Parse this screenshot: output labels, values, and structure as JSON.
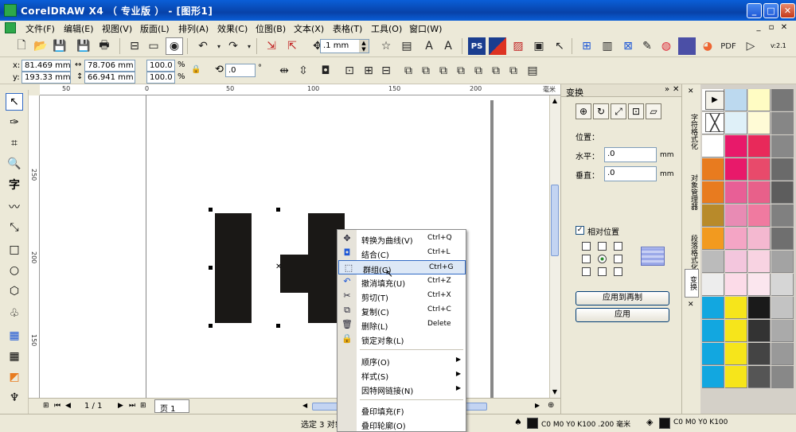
{
  "window": {
    "title": "CorelDRAW X4 （ 专业版 ） - [图形1]",
    "minimize": "_",
    "maximize": "□",
    "close": "✕"
  },
  "menu": [
    "文件(F)",
    "编辑(E)",
    "视图(V)",
    "版面(L)",
    "排列(A)",
    "效果(C)",
    "位图(B)",
    "文本(X)",
    "表格(T)",
    "工具(O)",
    "窗口(W)"
  ],
  "mdi": {
    "min": "_",
    "restore": "▫",
    "close": "✕"
  },
  "toolbar": {
    "nudge_value": ".1 mm",
    "ver_label": "v:2.1"
  },
  "propbar": {
    "x_label": "x:",
    "x_value": "81.469 mm",
    "y_label": "y:",
    "y_value": "193.33 mm",
    "w_value": "78.706 mm",
    "h_value": "66.941 mm",
    "sx_value": "100.0",
    "sy_value": "100.0",
    "pct": "%",
    "rot_value": ".0",
    "deg": "°"
  },
  "rulers": {
    "h_ticks": [
      "50",
      "0",
      "50",
      "100",
      "150",
      "200",
      "毫米"
    ],
    "v_ticks": [
      "250",
      "200",
      "150"
    ]
  },
  "context_menu": {
    "items": [
      {
        "label": "转换为曲线(V)",
        "shortcut": "Ctrl+Q",
        "icon": "convert-curves-icon"
      },
      {
        "label": "结合(C)",
        "shortcut": "Ctrl+L",
        "icon": "combine-icon"
      },
      {
        "label": "群组(G)",
        "shortcut": "Ctrl+G",
        "icon": "group-icon",
        "highlight": true
      },
      {
        "label": "撤消填充(U)",
        "shortcut": "Ctrl+Z",
        "icon": "undo-icon"
      },
      {
        "label": "剪切(T)",
        "shortcut": "Ctrl+X",
        "icon": "cut-icon"
      },
      {
        "label": "复制(C)",
        "shortcut": "Ctrl+C",
        "icon": "copy-icon"
      },
      {
        "label": "删除(L)",
        "shortcut": "Delete",
        "icon": "delete-icon"
      },
      {
        "label": "锁定对象(L)",
        "shortcut": "",
        "icon": "lock-icon"
      }
    ],
    "submenus": [
      {
        "label": "顺序(O)"
      },
      {
        "label": "样式(S)"
      },
      {
        "label": "因特网链接(N)"
      }
    ],
    "bottom": [
      {
        "label": "叠印填充(F)"
      },
      {
        "label": "叠印轮廓(O)"
      }
    ]
  },
  "docker": {
    "title": "变换",
    "position_label": "位置：",
    "horizontal_label": "水平：",
    "horizontal_value": ".0",
    "vertical_label": "垂直：",
    "vertical_value": ".0",
    "unit": "mm",
    "relative_label": "相对位置",
    "relative_checked": true,
    "apply_dup": "应用到再制",
    "apply": "应用"
  },
  "side_tabs": [
    "字符格式化",
    "对象管理器",
    "段落格式化",
    "变换"
  ],
  "status": {
    "page_count": "1 / 1",
    "page_tab": "页 1",
    "selection_text": "选定 3 对象",
    "fill_info": "C0 M0 Y0 K100  .200 毫米",
    "outline_info": "C0 M0 Y0 K100"
  },
  "palette_colors": [
    [
      "#ffffff",
      "#bcd9ef",
      "#fffcc3",
      "#777777"
    ],
    [
      "#ffffff",
      "#dff0f8",
      "#fffbd6",
      "#868686"
    ],
    [
      "#ffffff",
      "#e8196a",
      "#e8295a",
      "#888888"
    ],
    [
      "#e87b1f",
      "#e8196a",
      "#e84a6b",
      "#6a6a6a"
    ],
    [
      "#e87b1f",
      "#e85f96",
      "#e8608a",
      "#5d5d5d"
    ],
    [
      "#b88a2a",
      "#e88bb4",
      "#f07aa0",
      "#808080"
    ],
    [
      "#f29a1f",
      "#f4a5c5",
      "#f4b8d0",
      "#6f6f6f"
    ],
    [
      "#bbbbbb",
      "#f3c6dd",
      "#f8d3e2",
      "#a3a3a3"
    ],
    [
      "#ededed",
      "#fcdbe8",
      "#fbe6ee",
      "#d6d6d6"
    ],
    [
      "#12a7e0",
      "#f6e51b",
      "#1a1a1a",
      "#c3c3c3"
    ],
    [
      "#12a7e0",
      "#f6e51b",
      "#333333",
      "#aaaaaa"
    ],
    [
      "#12a7e0",
      "#f6e51b",
      "#444444",
      "#999999"
    ],
    [
      "#12a7e0",
      "#f6e51b",
      "#555555",
      "#888888"
    ]
  ]
}
